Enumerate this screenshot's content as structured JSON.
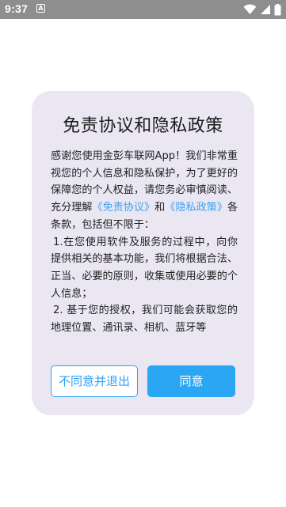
{
  "status_bar": {
    "time": "9:37",
    "notification_letter": "A"
  },
  "dialog": {
    "title": "免责协议和隐私政策",
    "intro_before_links": "感谢您使用金彭车联网App！我们非常重视您的个人信息和隐私保护，为了更好的保障您的个人权益，请您务必审慎阅读、充分理解",
    "link_disclaimer": "《免责协议》",
    "and_text": "和",
    "link_privacy": "《隐私政策》",
    "intro_after_links": "各条款，包括但不限于：",
    "item_1": "1.在您使用软件及服务的过程中，向你提供相关的基本功能，我们将根据合法、正当、必要的原则，收集或使用必要的个人信息；",
    "item_2": "2. 基于您的授权，我们可能会获取您的地理位置、通讯录、相机、蓝牙等",
    "decline_label": "不同意并退出",
    "agree_label": "同意"
  },
  "colors": {
    "link": "#3aa3f0",
    "primary": "#2aa6f5",
    "card_background": "#eae7f3",
    "status_bar": "#8e8e8e"
  },
  "icons": [
    "notification-a-icon",
    "wifi-icon",
    "signal-icon",
    "battery-icon"
  ]
}
